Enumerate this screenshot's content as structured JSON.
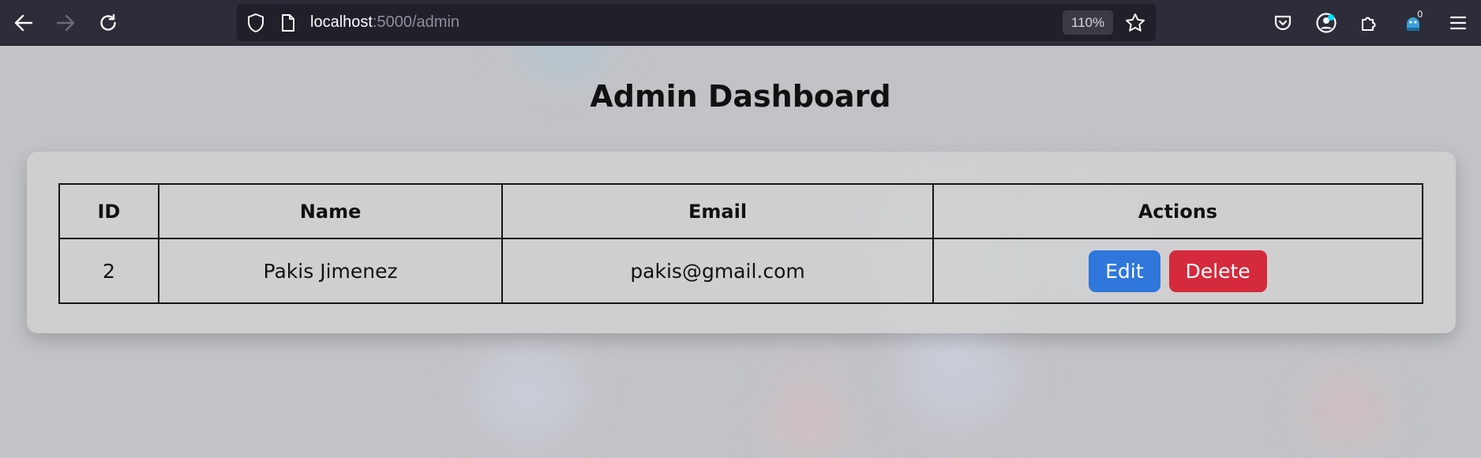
{
  "browser": {
    "url_host": "localhost",
    "url_path": ":5000/admin",
    "zoom": "110%",
    "extension_badge_count": "0",
    "icons": {
      "back": "arrow-left-icon",
      "forward": "arrow-right-icon",
      "reload": "reload-icon",
      "tracking_protection": "shield-icon",
      "page_info": "page-icon",
      "bookmark": "star-icon",
      "pocket": "pocket-icon",
      "account": "account-icon",
      "extensions": "puzzle-icon",
      "extension_app": "extension-icon",
      "menu": "hamburger-menu-icon"
    }
  },
  "page": {
    "title": "Admin Dashboard"
  },
  "table": {
    "headers": [
      "ID",
      "Name",
      "Email",
      "Actions"
    ],
    "rows": [
      {
        "id": "2",
        "name": "Pakis Jimenez",
        "email": "pakis@gmail.com",
        "actions": {
          "edit": "Edit",
          "delete": "Delete"
        }
      }
    ]
  },
  "colors": {
    "edit_button": "#2f77db",
    "delete_button": "#d42a3c",
    "toolbar": "#2c2d38"
  }
}
